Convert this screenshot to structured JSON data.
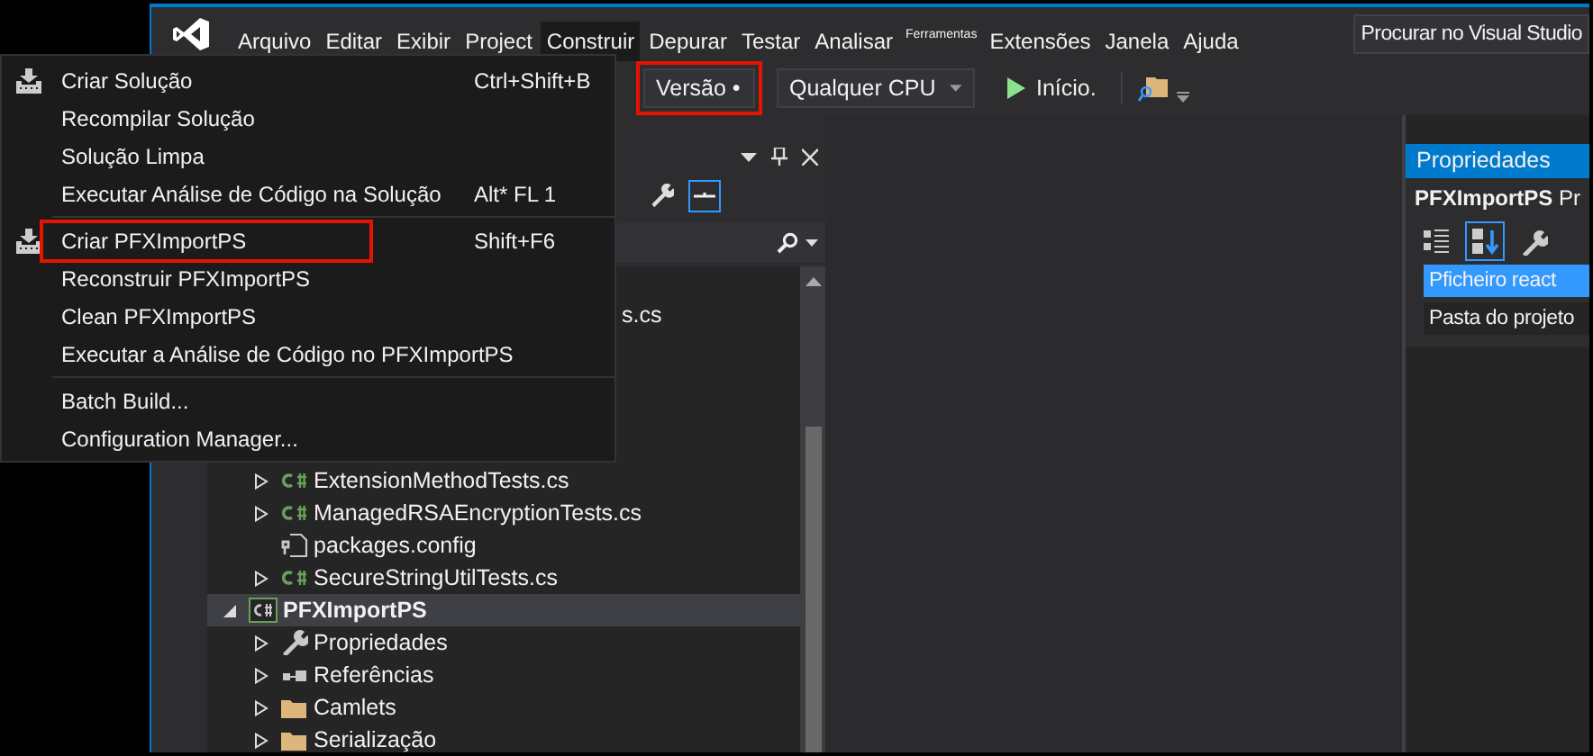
{
  "title_bar": {
    "menus": [
      {
        "label": "Arquivo",
        "kind": "normal",
        "selected": false
      },
      {
        "label": "Editar",
        "kind": "normal",
        "selected": false
      },
      {
        "label": "Exibir",
        "kind": "normal",
        "selected": false
      },
      {
        "label": "Project",
        "kind": "normal",
        "selected": false
      },
      {
        "label": "Construir",
        "kind": "normal",
        "selected": true
      },
      {
        "label": "Depurar",
        "kind": "normal",
        "selected": false
      },
      {
        "label": "Testar",
        "kind": "normal",
        "selected": false
      },
      {
        "label": "Analisar",
        "kind": "normal",
        "selected": false
      },
      {
        "label": "Ferramentas",
        "kind": "compact",
        "selected": false
      },
      {
        "label": "Extensões",
        "kind": "normal",
        "selected": false
      },
      {
        "label": "Janela",
        "kind": "normal",
        "selected": false
      },
      {
        "label": "Ajuda",
        "kind": "normal",
        "selected": false
      }
    ],
    "search": {
      "placeholder": "Procurar no Visual Studio"
    }
  },
  "toolbar": {
    "configuration": {
      "value": "Versão •",
      "highlighted": true
    },
    "platform": {
      "value": "Qualquer CPU"
    },
    "start": {
      "label": "Início."
    }
  },
  "build_menu": {
    "items": [
      {
        "kind": "build_command",
        "label": "Criar Solução",
        "shortcut": "Ctrl+Shift+B",
        "highlighted": false
      },
      {
        "kind": "command",
        "label": "Recompilar Solução",
        "highlighted": false
      },
      {
        "kind": "command",
        "label": "Solução Limpa",
        "highlighted": false
      },
      {
        "kind": "command",
        "label": "Executar Análise de Código na Solução",
        "shortcut": "Alt* FL 1",
        "highlighted": false
      },
      {
        "kind": "separator"
      },
      {
        "kind": "build_command",
        "label": "Criar PFXImportPS",
        "shortcut": "Shift+F6",
        "highlighted": true
      },
      {
        "kind": "command",
        "label": "Reconstruir PFXImportPS",
        "highlighted": false
      },
      {
        "kind": "command",
        "label": "Clean PFXImportPS",
        "highlighted": false
      },
      {
        "kind": "command",
        "label": "Executar a Análise de Código no PFXImportPS",
        "highlighted": false
      },
      {
        "kind": "separator"
      },
      {
        "kind": "command",
        "label": "Batch Build...",
        "highlighted": false
      },
      {
        "kind": "command",
        "label": "Configuration Manager...",
        "highlighted": false
      }
    ]
  },
  "solution_explorer": {
    "fragment": "s.cs",
    "items": [
      {
        "children": [
          {
            "label": "ExtensionMethodTests.cs",
            "kind": "csharp",
            "expanded": false,
            "selected": false
          },
          {
            "label": "ManagedRSAEncryptionTests.cs",
            "kind": "csharp",
            "expanded": false,
            "selected": false
          },
          {
            "label": "packages.config",
            "kind": "config",
            "selected": false
          },
          {
            "label": "SecureStringUtilTests.cs",
            "kind": "csharp",
            "expanded": false,
            "selected": false
          }
        ]
      },
      {
        "label": "PFXImportPS",
        "kind": "project",
        "expanded": true,
        "selected": true,
        "children": [
          {
            "label": "Propriedades",
            "kind": "wrench",
            "expanded": false,
            "selected": false
          },
          {
            "label": "Referências",
            "kind": "references",
            "expanded": false,
            "selected": false
          },
          {
            "label": "Camlets",
            "kind": "folder",
            "expanded": false,
            "selected": false
          },
          {
            "label": "Serialização",
            "kind": "folder",
            "expanded": false,
            "selected": false
          }
        ]
      }
    ]
  },
  "properties": {
    "title": "Propriedades",
    "object": "PFXImportPS",
    "object_type": "Pr",
    "tools": [
      {
        "kind": "categorized",
        "selected": false
      },
      {
        "kind": "alphabetical",
        "selected": true
      },
      {
        "kind": "pages",
        "selected": false
      }
    ],
    "rows": [
      {
        "label": "Pficheiro react",
        "selected": true
      },
      {
        "label": "Pasta do projeto",
        "selected": false
      }
    ]
  }
}
